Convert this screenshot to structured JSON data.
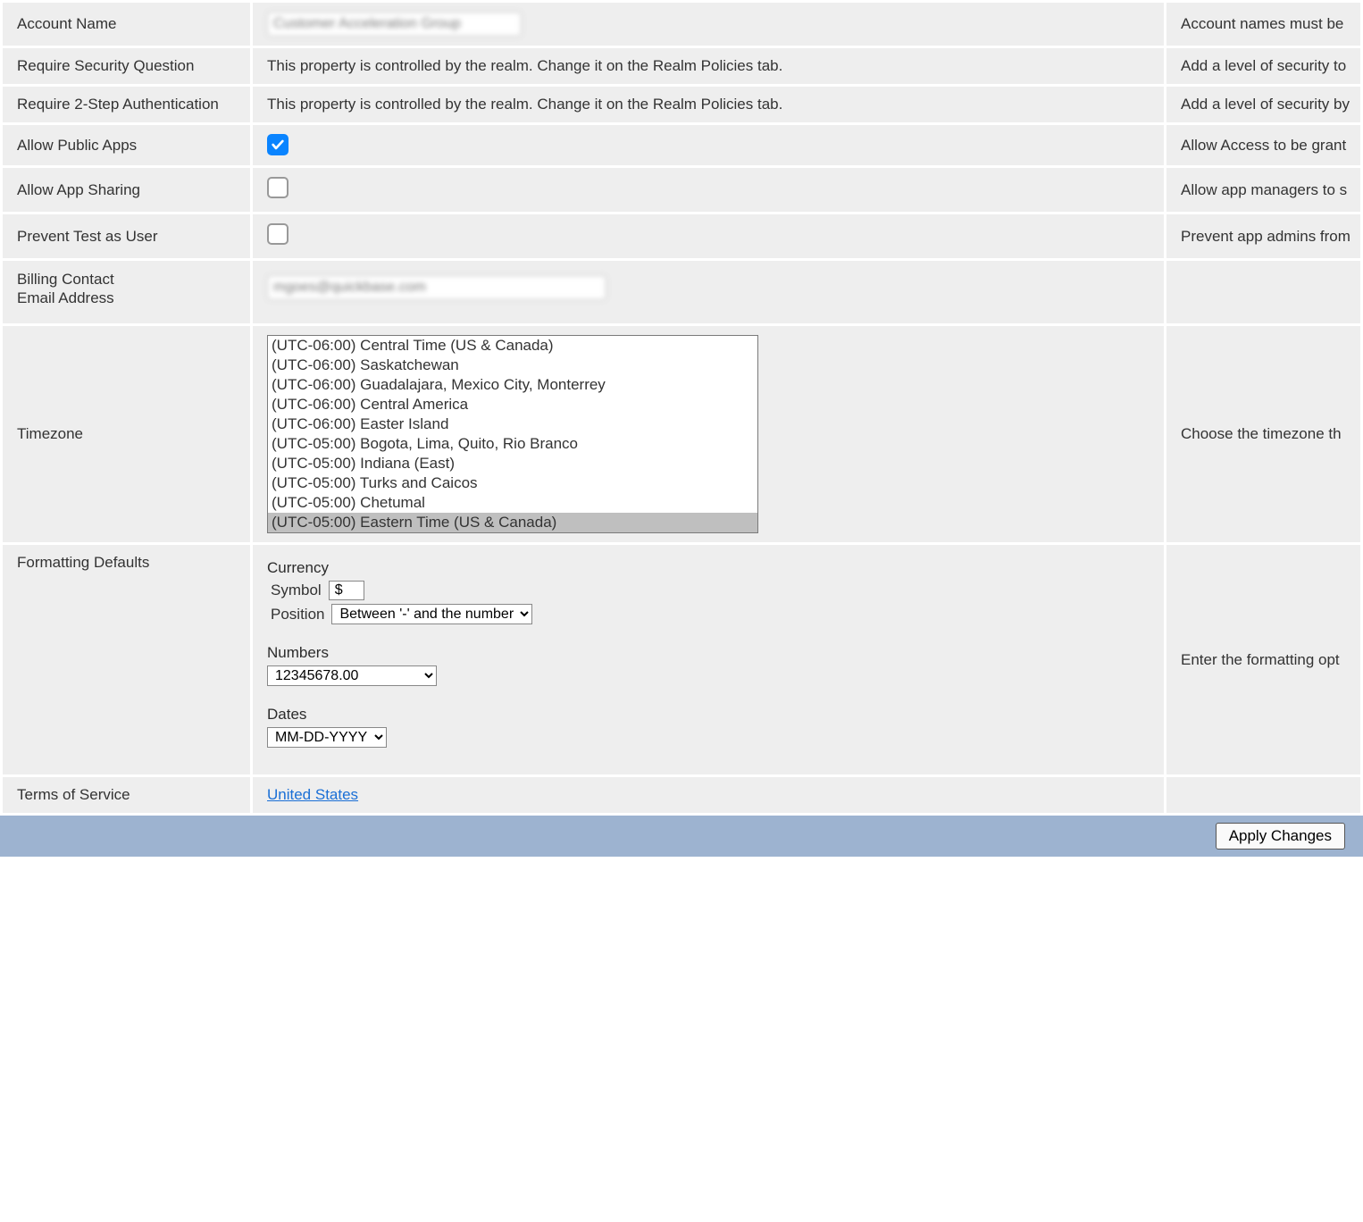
{
  "rows": {
    "account_name": {
      "label": "Account Name",
      "value": "Customer Acceleration Group",
      "desc": "Account names must be"
    },
    "require_security_question": {
      "label": "Require Security Question",
      "value_text": "This property is controlled by the realm. Change it on the Realm Policies tab.",
      "desc": "Add a level of security to"
    },
    "require_2step": {
      "label": "Require 2-Step Authentication",
      "value_text": "This property is controlled by the realm. Change it on the Realm Policies tab.",
      "desc": "Add a level of security by"
    },
    "allow_public_apps": {
      "label": "Allow Public Apps",
      "checked": true,
      "desc": "Allow Access to be grant"
    },
    "allow_app_sharing": {
      "label": "Allow App Sharing",
      "checked": false,
      "desc": "Allow app managers to s"
    },
    "prevent_test_as_user": {
      "label": "Prevent Test as User",
      "checked": false,
      "desc": "Prevent app admins from"
    },
    "billing_contact": {
      "label_line1": "Billing Contact",
      "label_line2": "Email Address",
      "value": "mgoes@quickbase.com",
      "desc": ""
    },
    "timezone": {
      "label": "Timezone",
      "desc": "Choose the timezone th"
    },
    "formatting": {
      "label": "Formatting Defaults",
      "desc": "Enter the formatting opt"
    },
    "terms": {
      "label": "Terms of Service",
      "link_text": "United States",
      "desc": ""
    }
  },
  "timezone_options": [
    "(UTC-06:00) Central Time (US & Canada)",
    "(UTC-06:00) Saskatchewan",
    "(UTC-06:00) Guadalajara, Mexico City, Monterrey",
    "(UTC-06:00) Central America",
    "(UTC-06:00) Easter Island",
    "(UTC-05:00) Bogota, Lima, Quito, Rio Branco",
    "(UTC-05:00) Indiana (East)",
    "(UTC-05:00) Turks and Caicos",
    "(UTC-05:00) Chetumal",
    "(UTC-05:00) Eastern Time (US & Canada)"
  ],
  "timezone_selected_index": 9,
  "formatting": {
    "currency_heading": "Currency",
    "symbol_label": "Symbol",
    "symbol_value": "$",
    "position_label": "Position",
    "position_value": "Between '-' and the number",
    "numbers_heading": "Numbers",
    "numbers_value": "12345678.00",
    "dates_heading": "Dates",
    "dates_value": "MM-DD-YYYY"
  },
  "footer": {
    "apply_label": "Apply Changes"
  }
}
